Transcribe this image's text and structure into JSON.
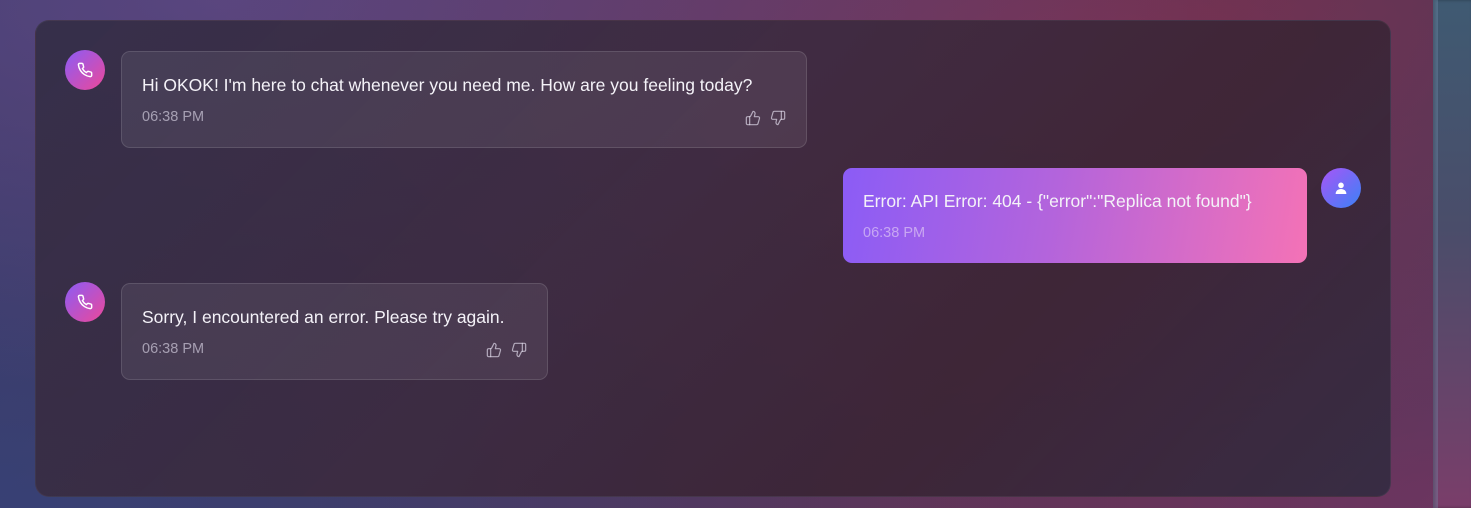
{
  "messages": [
    {
      "sender": "bot",
      "text": "Hi OKOK! I'm here to chat whenever you need me. How are you feeling today?",
      "time": "06:38 PM"
    },
    {
      "sender": "user",
      "text": "Error: API Error: 404 - {\"error\":\"Replica not found\"}",
      "time": "06:38 PM"
    },
    {
      "sender": "bot",
      "text": "Sorry, I encountered an error. Please try again.",
      "time": "06:38 PM"
    }
  ],
  "icons": {
    "bot_avatar": "phone-icon",
    "user_avatar": "user-icon",
    "like": "thumbs-up-icon",
    "dislike": "thumbs-down-icon"
  },
  "colors": {
    "bot_avatar_gradient": [
      "#8b5cf6",
      "#ec4899"
    ],
    "user_avatar_gradient": [
      "#a855f7",
      "#3b82f6"
    ],
    "user_bubble_gradient": [
      "#8b5cf6",
      "#f472b6"
    ]
  }
}
